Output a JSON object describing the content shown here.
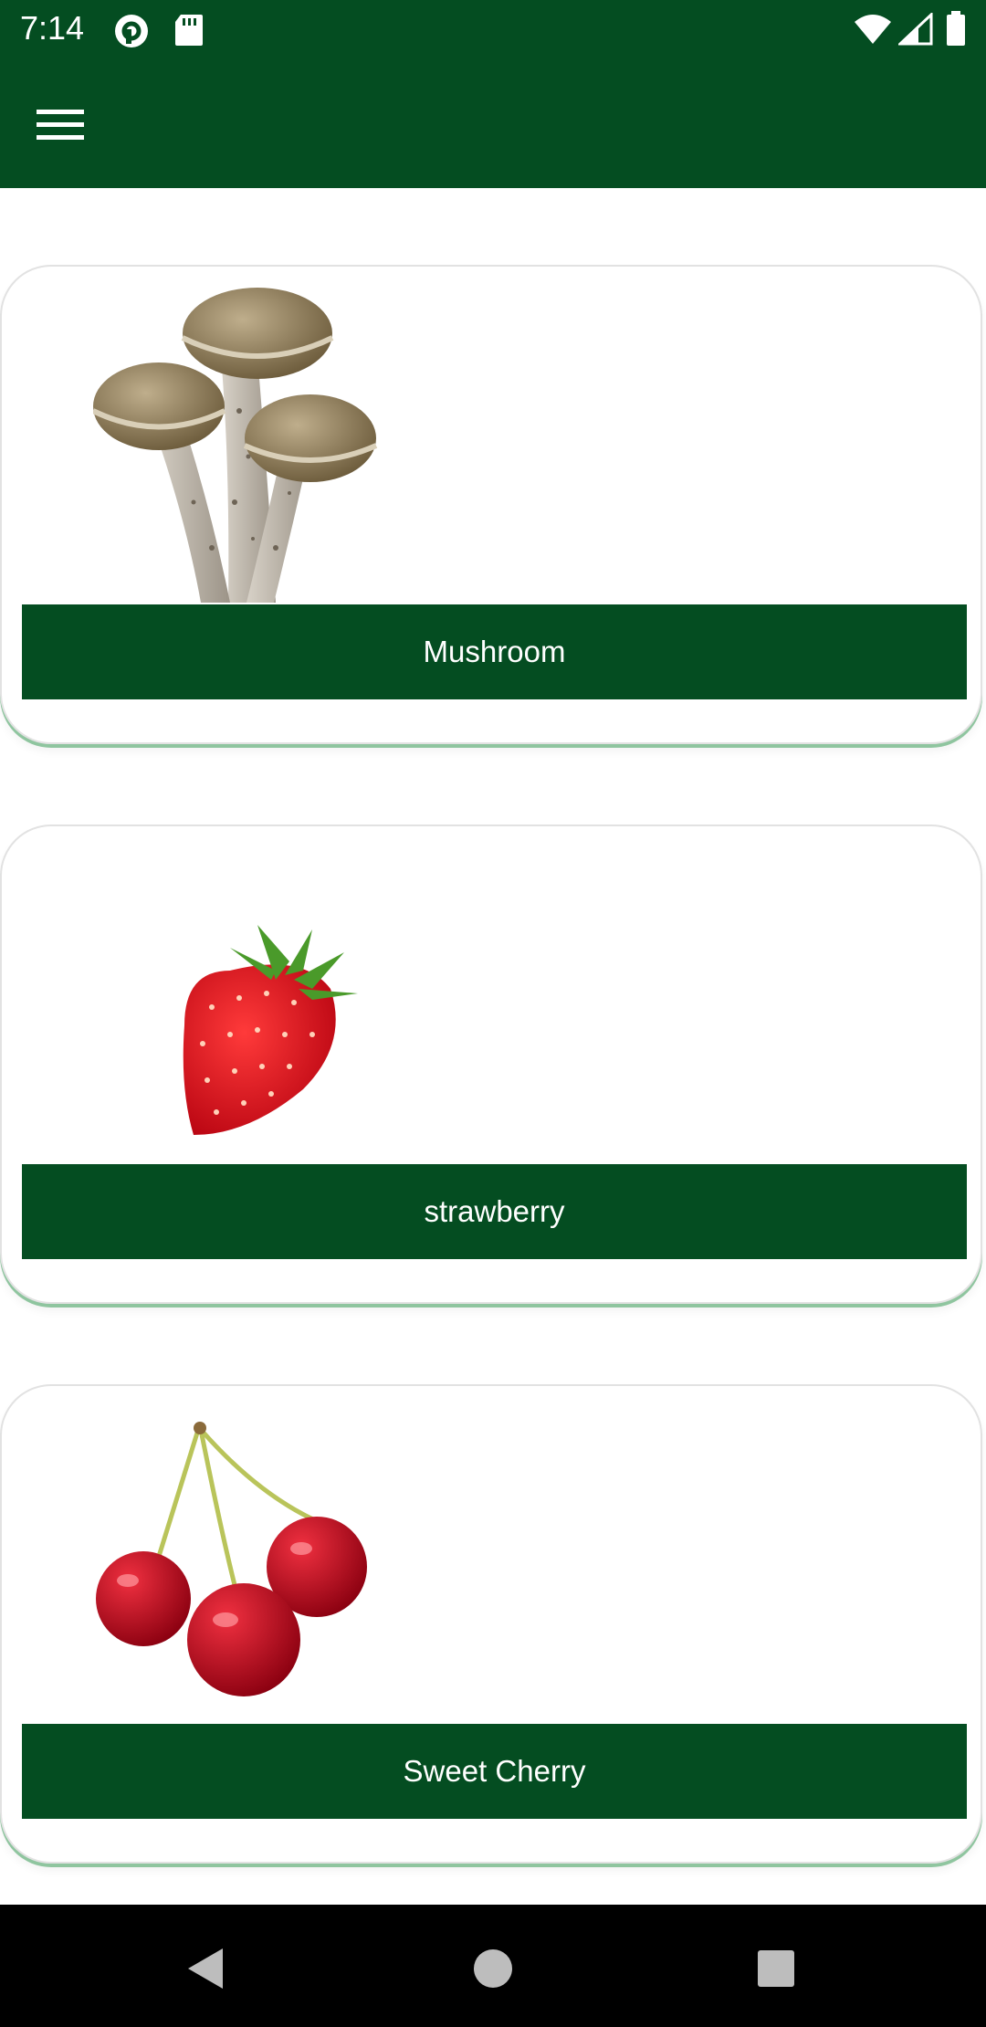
{
  "status_bar": {
    "time": "7:14",
    "icons": [
      "pocket-casts-icon",
      "sd-card-icon",
      "wifi-icon",
      "signal-icon",
      "battery-icon"
    ]
  },
  "app_bar": {
    "menu_icon": "hamburger-menu-icon"
  },
  "items": [
    {
      "label": "Mushroom",
      "image": "mushroom"
    },
    {
      "label": "strawberry",
      "image": "strawberry"
    },
    {
      "label": "Sweet Cherry",
      "image": "sweet-cherry"
    }
  ],
  "nav_bar": {
    "icons": [
      "back-icon",
      "home-icon",
      "recents-icon"
    ]
  },
  "colors": {
    "primary": "#044d21",
    "card_shadow": "#8fc59f",
    "background": "#ffffff"
  }
}
